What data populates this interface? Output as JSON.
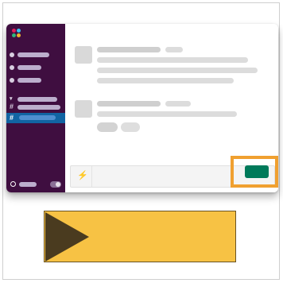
{
  "colors": {
    "sidebar_bg": "#3f0e40",
    "selected_channel": "#1164a3",
    "send_button": "#007a5a",
    "highlight_border": "#f0a030",
    "banner_fill": "#f7c244",
    "banner_arrow": "#4a3b1f"
  },
  "icons": {
    "logo": "app-logo-icon",
    "composer_shortcut": "lightning-bolt-icon",
    "play": "play-icon"
  }
}
